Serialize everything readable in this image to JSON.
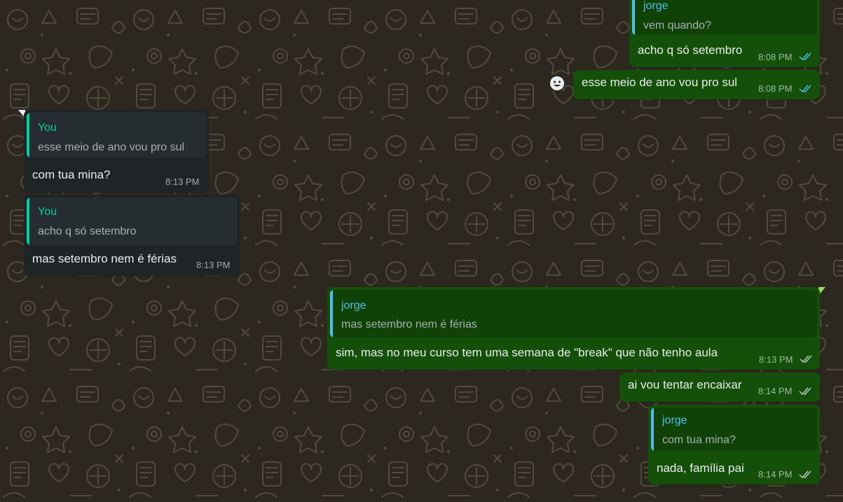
{
  "colors": {
    "wallpaper": "#2d281f",
    "incoming_bubble": "#1f2427",
    "outgoing_bubble": "#145009",
    "quote_author_you": "#06cf9c",
    "quote_author_jorge": "#53bdeb",
    "read_ticks": "#53bdeb",
    "delivered_ticks": "#c7cacc"
  },
  "messages": [
    {
      "direction": "outgoing",
      "quote": {
        "author": "jorge",
        "text": "vem quando?"
      },
      "text": "acho q só setembro",
      "time": "8:08 PM",
      "status": "read"
    },
    {
      "direction": "outgoing",
      "text": "esse meio de ano vou pro sul",
      "time": "8:08 PM",
      "status": "read"
    },
    {
      "direction": "incoming",
      "quote": {
        "author": "You",
        "text": "esse meio de ano vou pro sul"
      },
      "text": "com tua mina?",
      "time": "8:13 PM"
    },
    {
      "direction": "incoming",
      "quote": {
        "author": "You",
        "text": "acho q só setembro"
      },
      "text": "mas setembro nem é férias",
      "time": "8:13 PM"
    },
    {
      "direction": "outgoing",
      "quote": {
        "author": "jorge",
        "text": "mas setembro nem é férias"
      },
      "text": "sim, mas no meu curso tem uma semana de \"break\" que não tenho aula",
      "time": "8:13 PM",
      "status": "delivered"
    },
    {
      "direction": "outgoing",
      "text": "ai vou tentar encaixar",
      "time": "8:14 PM",
      "status": "delivered"
    },
    {
      "direction": "outgoing",
      "quote": {
        "author": "jorge",
        "text": "com tua mina?"
      },
      "text": "nada, família pai",
      "time": "8:14 PM",
      "status": "delivered"
    }
  ],
  "icons": {
    "reaction_button": "smiley-face-icon",
    "read_status": "double-check-icon",
    "delivered_status": "double-check-icon",
    "wallpaper": "doodle-pattern-icon"
  }
}
